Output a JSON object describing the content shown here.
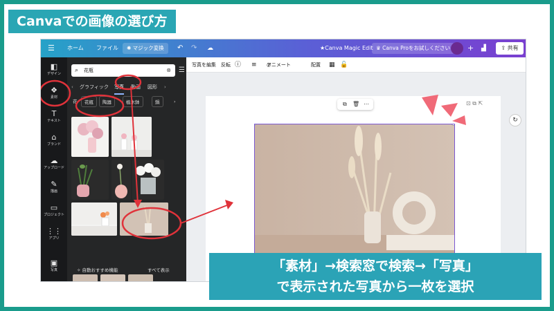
{
  "title": "Canvaでの画像の選び方",
  "topbar": {
    "menu_icon": "hamburger-icon",
    "home": "ホーム",
    "file": "ファイル",
    "magic": "マジック変換",
    "magic_edit": "★Canva Magic Edit",
    "pro": "Canva Proをお試しください",
    "plus": "+",
    "share": "共有"
  },
  "rail": [
    {
      "label": "デザイン",
      "icon": "design-icon"
    },
    {
      "label": "素材",
      "icon": "elements-icon"
    },
    {
      "label": "テキスト",
      "icon": "text-icon"
    },
    {
      "label": "ブランド",
      "icon": "brand-icon"
    },
    {
      "label": "アップロード",
      "icon": "upload-icon"
    },
    {
      "label": "描画",
      "icon": "draw-icon"
    },
    {
      "label": "プロジェクト",
      "icon": "folder-icon"
    },
    {
      "label": "アプリ",
      "icon": "apps-icon"
    },
    {
      "label": "写真",
      "icon": "photos-icon"
    }
  ],
  "panel": {
    "search_value": "花瓶",
    "tabs": [
      "グラフィック",
      "写真",
      "動画",
      "図形"
    ],
    "chips": [
      "花",
      "花瓶",
      "陶器",
      "植木鉢",
      "鍋"
    ],
    "recommend": "自動おすすめ機能",
    "see_all": "すべて表示"
  },
  "toolbar": {
    "edit_photo": "写真を編集",
    "flip": "反転",
    "animate": "アニメート",
    "position": "配置"
  },
  "caption": {
    "line1": "「素材」→検索窓で検索→「写真」",
    "line2": "で表示された写真から一枚を選択"
  },
  "colors": {
    "frame": "#1a9c8c",
    "accent": "#2aa6b4",
    "annotation": "#e0323a"
  }
}
